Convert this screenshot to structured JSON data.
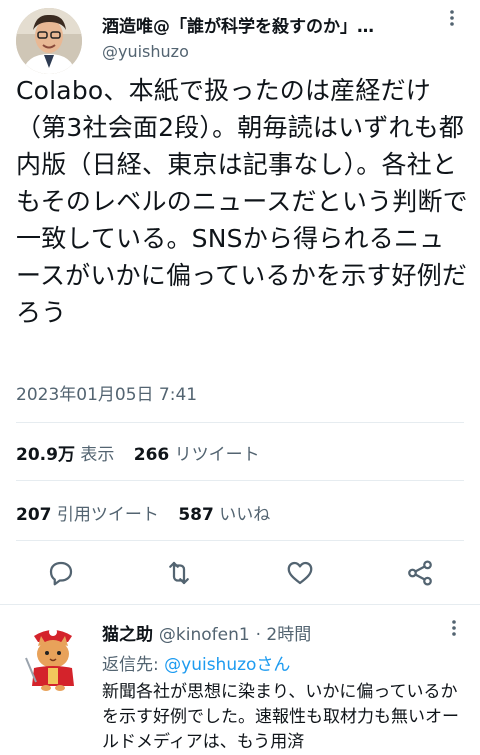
{
  "tweet": {
    "display_name": "酒造唯@「誰が科学を殺すのか」…",
    "handle": "@yuishuzo",
    "text": "Colabo、本紙で扱ったのは産経だけ（第3社会面2段）。朝毎読はいずれも都内版（日経、東京は記事なし）。各社ともそのレベルのニュースだという判断で一致している。SNSから得られるニュースがいかに偏っているかを示す好例だろう",
    "timestamp": "2023年01月05日 7:41",
    "views_count": "20.9万",
    "views_label": "表示",
    "retweets_count": "266",
    "retweets_label": "リツイート",
    "quotes_count": "207",
    "quotes_label": "引用ツイート",
    "likes_count": "587",
    "likes_label": "いいね"
  },
  "reply": {
    "name": "猫之助",
    "handle": "@kinofen1",
    "time": "· 2時間",
    "reply_to_label": "返信先:",
    "reply_to_handle": "@yuishuzoさん",
    "text": "新聞各社が思想に染まり、いかに偏っているかを示す好例でした。速報性も取材力も無いオールドメディアは、もう用済"
  },
  "colors": {
    "accent": "#1d9bf0",
    "secondary_text": "#536471",
    "divider": "#e6ecf0"
  },
  "icons": [
    "more-icon",
    "reply-icon",
    "retweet-icon",
    "like-icon",
    "share-icon"
  ]
}
